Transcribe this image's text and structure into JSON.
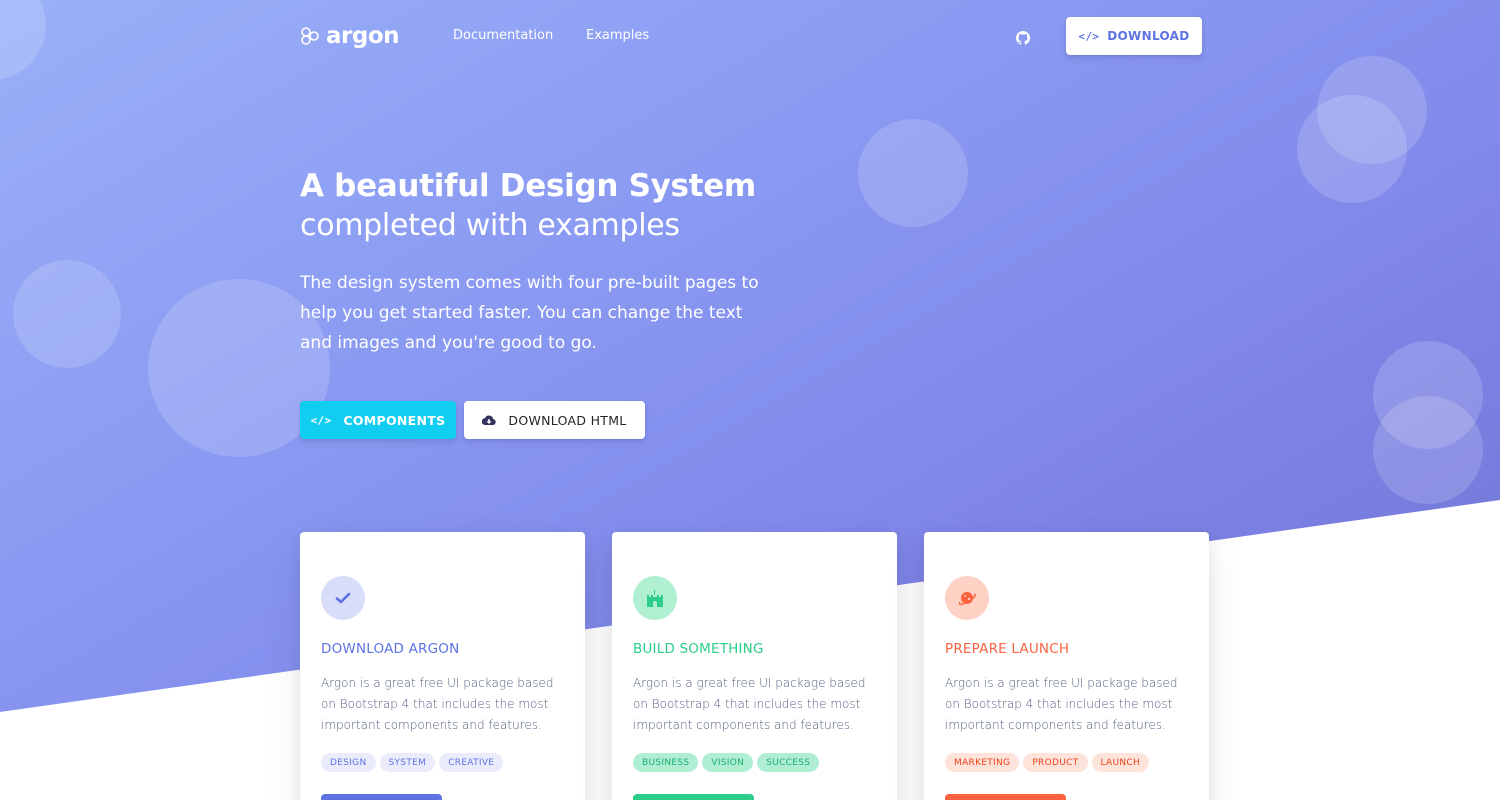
{
  "nav": {
    "brand": "argon",
    "links": [
      "Documentation",
      "Examples"
    ],
    "github_icon": "github-icon",
    "download_label": "DOWNLOAD",
    "download_icon": "code-icon"
  },
  "hero": {
    "title_bold": "A beautiful Design System",
    "title_light": "completed with examples",
    "lead": "The design system comes with four pre-built pages to help you get started faster. You can change the text and images and you're good to go.",
    "components_button": "COMPONENTS",
    "download_html_button": "DOWNLOAD HTML"
  },
  "colors": {
    "primary": "#5e72e4",
    "info": "#11cdef",
    "success": "#2dce89",
    "warning": "#fb6340"
  },
  "cards": [
    {
      "icon": "check-icon",
      "title": "DOWNLOAD ARGON",
      "description": "Argon is a great free UI package based on Bootstrap 4 that includes the most important components and features.",
      "tags": [
        "DESIGN",
        "SYSTEM",
        "CREATIVE"
      ],
      "color": "#5e72e4"
    },
    {
      "icon": "castle-icon",
      "title": "BUILD SOMETHING",
      "description": "Argon is a great free UI package based on Bootstrap 4 that includes the most important components and features.",
      "tags": [
        "BUSINESS",
        "VISION",
        "SUCCESS"
      ],
      "color": "#2dce89"
    },
    {
      "icon": "planet-icon",
      "title": "PREPARE LAUNCH",
      "description": "Argon is a great free UI package based on Bootstrap 4 that includes the most important components and features.",
      "tags": [
        "MARKETING",
        "PRODUCT",
        "LAUNCH"
      ],
      "color": "#fb6340"
    }
  ]
}
